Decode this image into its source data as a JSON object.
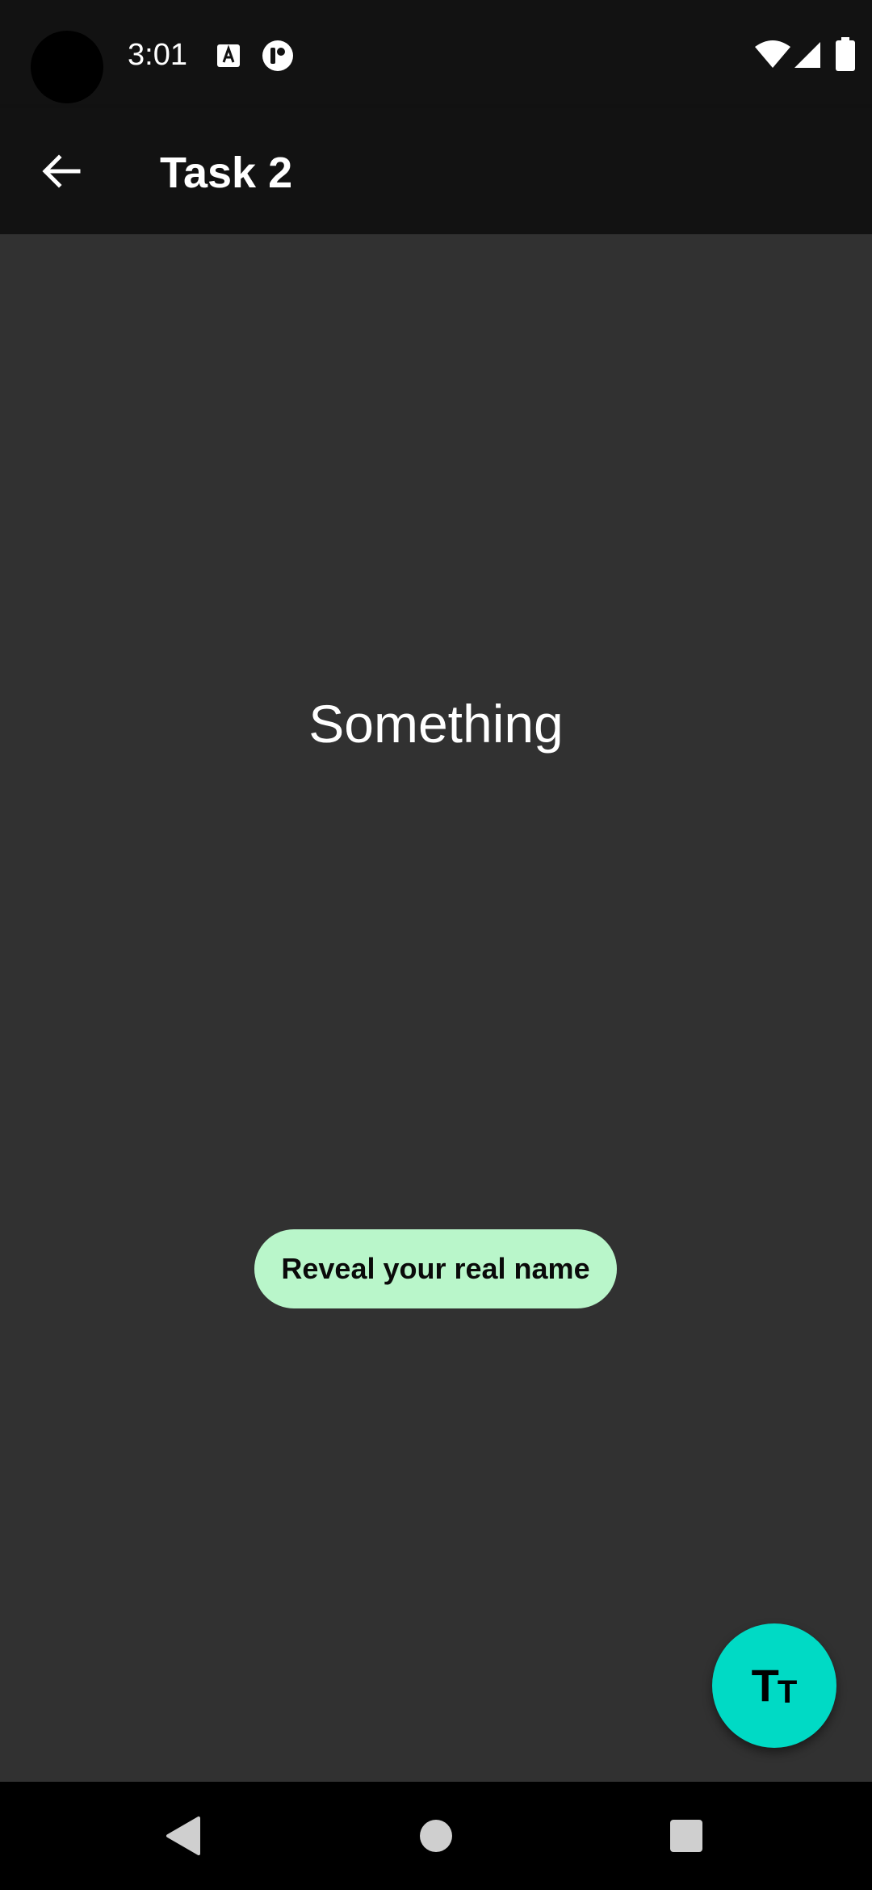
{
  "status_bar": {
    "time": "3:01",
    "icons": [
      "text-format-a-icon",
      "pocket-app-icon",
      "wifi-icon",
      "cell-signal-icon",
      "battery-icon"
    ]
  },
  "app_bar": {
    "title": "Task 2",
    "back_icon": "arrow-back-icon"
  },
  "content": {
    "main_text": "Something",
    "reveal_button_label": "Reveal your real name"
  },
  "fab": {
    "icon": "text-size-icon",
    "glyph_large": "T",
    "glyph_small": "T"
  },
  "nav_bar": {
    "buttons": [
      "back-triangle-icon",
      "home-circle-icon",
      "recents-square-icon"
    ]
  },
  "colors": {
    "background": "#313131",
    "app_bar": "#121212",
    "button_bg": "#b9f6ca",
    "fab_bg": "#00dac5",
    "nav_bar": "#000000"
  }
}
